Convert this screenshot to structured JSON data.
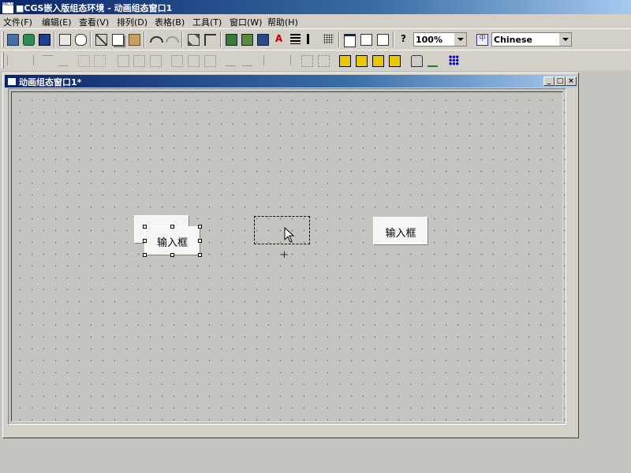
{
  "window": {
    "icon_text": "MCGS",
    "title": "■CGS嵌入版组态环境 - 动画组态窗口1"
  },
  "menu": [
    "文件(F)",
    "编辑(E)",
    "查看(V)",
    "排列(D)",
    "表格(B)",
    "工具(T)",
    "窗口(W)",
    "帮助(H)"
  ],
  "toolbar": {
    "zoom_value": "100%",
    "language_value": "Chinese"
  },
  "child_window": {
    "title": "动画组态窗口1*",
    "minimize_glyph": "_",
    "maximize_glyph": "□",
    "close_glyph": "×"
  },
  "canvas": {
    "input_boxes": [
      {
        "label": ""
      },
      {
        "label": "输入框"
      },
      {
        "label": "输入框"
      }
    ],
    "crosshair": "+"
  }
}
